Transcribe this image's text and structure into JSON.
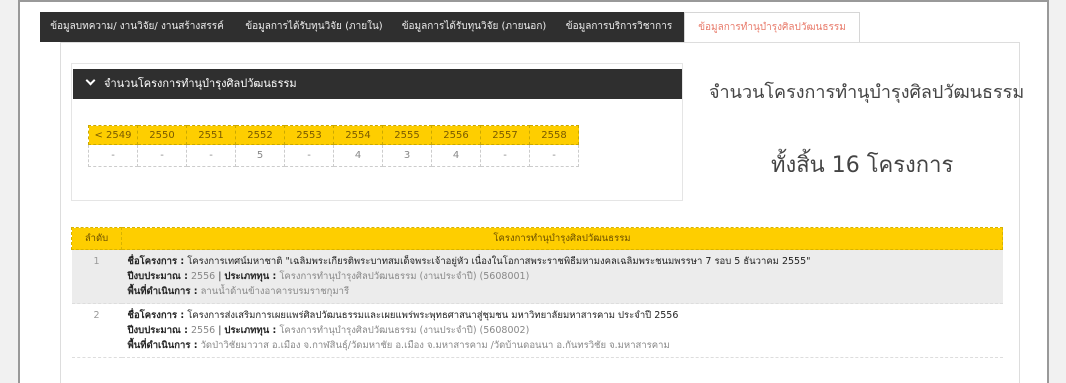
{
  "tabs": [
    {
      "label": "ข้อมูลบทความ/ งานวิจัย/ งานสร้างสรรค์",
      "active": false
    },
    {
      "label": "ข้อมูลการได้รับทุนวิจัย (ภายใน)",
      "active": false
    },
    {
      "label": "ข้อมูลการได้รับทุนวิจัย (ภายนอก)",
      "active": false
    },
    {
      "label": "ข้อมูลการบริการวิชาการ",
      "active": false
    },
    {
      "label": "ข้อมูลการทำนุบำรุงศิลปวัฒนธรรม",
      "active": true
    }
  ],
  "stats": {
    "header": "จำนวนโครงการทำนุบำรุงศิลปวัฒนธรรม",
    "years": [
      "< 2549",
      "2550",
      "2551",
      "2552",
      "2553",
      "2554",
      "2555",
      "2556",
      "2557",
      "2558"
    ],
    "counts": [
      "-",
      "-",
      "-",
      "5",
      "-",
      "4",
      "3",
      "4",
      "-",
      "-"
    ]
  },
  "summary": {
    "title": "จำนวนโครงการทำนุบำรุงศิลปวัฒนธรรม",
    "total": "ทั้งสิ้น 16 โครงการ"
  },
  "list": {
    "col_no": "ลำดับ",
    "col_project": "โครงการทำนุบำรุงศิลปวัฒนธรรม",
    "label_name": "ชื่อโครงการ :",
    "label_year": "ปีงบประมาณ :",
    "label_type": "ประเภททุน :",
    "label_area": "พื้นที่ดำเนินการ :",
    "rows": [
      {
        "no": "1",
        "name": "โครงการเทศน์มหาชาติ \"เฉลิมพระเกียรติพระบาทสมเด็จพระเจ้าอยู่หัว เนื่องในโอกาสพระราชพิธีมหามงคลเฉลิมพระชนมพรรษา 7 รอบ 5 ธันวาคม 2555\"",
        "year": "2556",
        "type": "โครงการทำนุบำรุงศิลปวัฒนธรรม (งานประจำปี) (5608001)",
        "area": "ลานน้ำด้านข้างอาคารบรมราชกุมารี"
      },
      {
        "no": "2",
        "name": "โครงการส่งเสริมการเผยแพร่ศิลปวัฒนธรรมและเผยแพร่พระพุทธศาสนาสู่ชุมชน มหาวิทยาลัยมหาสารคาม ประจำปี 2556",
        "year": "2556",
        "type": "โครงการทำนุบำรุงศิลปวัฒนธรรม (งานประจำปี) (5608002)",
        "area": "วัดป่าวิชัยมาวาส อ.เมือง จ.กาฬสินธุ์/วัดมหาชัย อ.เมือง จ.มหาสารคาม /วัดบ้านดอนนา อ.กันทรวิชัย จ.มหาสารคาม"
      }
    ]
  }
}
